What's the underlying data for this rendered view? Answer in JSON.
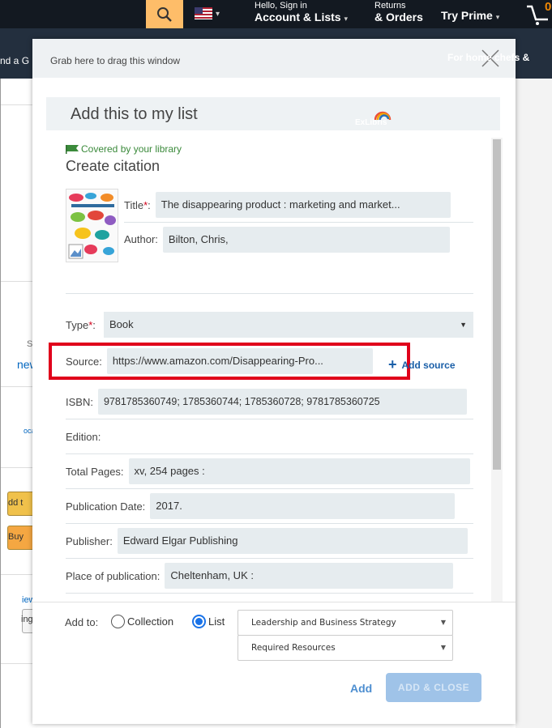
{
  "amazon": {
    "account_small": "Hello, Sign in",
    "account_big": "Account & Lists",
    "returns_small": "Returns",
    "returns_big": "& Orders",
    "prime": "Try Prime",
    "cart_count": "0",
    "subbar_left": "nd a G",
    "subbar_right": "For home chefs &",
    "left_fragments": [
      "S",
      "new",
      "oca",
      "dd t",
      "Buy",
      "iew",
      "ing"
    ],
    "colors": {
      "topbar": "#131921",
      "subbar": "#232f3e",
      "search": "#febd69"
    }
  },
  "modal": {
    "drag_label": "Grab here to drag this window",
    "panel_title": "Add this to my list",
    "logo_text": "ExLibris",
    "covered_text": "Covered by your library",
    "section_title": "Create citation",
    "fields": {
      "title": {
        "label": "Title",
        "value": "The disappearing product : marketing and market..."
      },
      "author": {
        "label": "Author:",
        "value": "Bilton, Chris,"
      },
      "type": {
        "label": "Type",
        "value": "Book"
      },
      "source": {
        "label": "Source:",
        "value": "https://www.amazon.com/Disappearing-Pro..."
      },
      "isbn": {
        "label": "ISBN:",
        "value": "9781785360749; 1785360744; 1785360728; 9781785360725"
      },
      "edition": {
        "label": "Edition:",
        "value": ""
      },
      "total_pages": {
        "label": "Total Pages:",
        "value": "xv, 254 pages :"
      },
      "publication_date": {
        "label": "Publication Date:",
        "value": "2017."
      },
      "publisher": {
        "label": "Publisher:",
        "value": "Edward Elgar Publishing"
      },
      "place": {
        "label": "Place of publication:",
        "value": "Cheltenham, UK :"
      }
    },
    "required_mark": "*",
    "required_suffix": ":",
    "add_source_label": "Add source",
    "add_to_label": "Add to:",
    "radio_collection": "Collection",
    "radio_list": "List",
    "list_dropdown": "Leadership and Business Strategy",
    "section_dropdown": "Required Resources",
    "add_label": "Add",
    "add_close_label": "ADD & CLOSE",
    "colors": {
      "accent": "#1a73e8",
      "highlight": "#e0001b",
      "field_bg": "#e6ecef",
      "library_green": "#3b8a3b"
    }
  }
}
